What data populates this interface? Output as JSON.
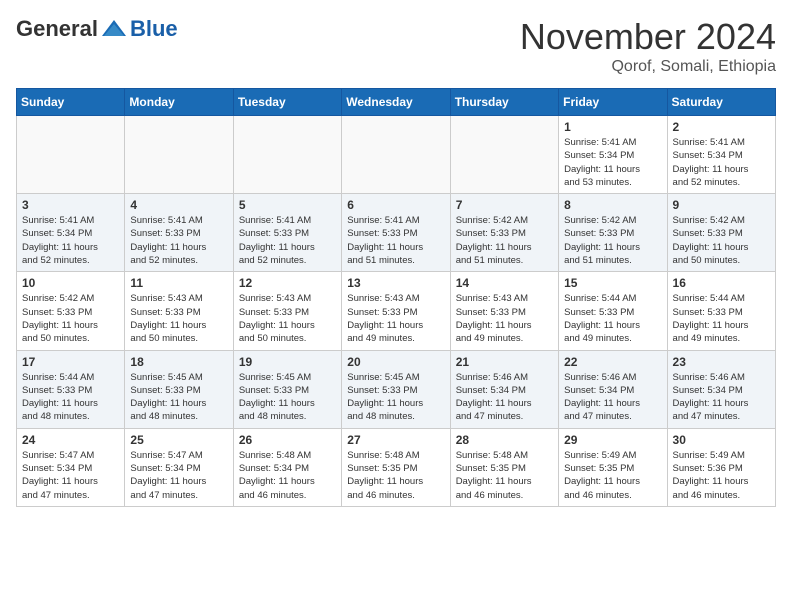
{
  "logo": {
    "general": "General",
    "blue": "Blue"
  },
  "header": {
    "month_title": "November 2024",
    "subtitle": "Qorof, Somali, Ethiopia"
  },
  "weekdays": [
    "Sunday",
    "Monday",
    "Tuesday",
    "Wednesday",
    "Thursday",
    "Friday",
    "Saturday"
  ],
  "weeks": [
    [
      {
        "day": "",
        "info": ""
      },
      {
        "day": "",
        "info": ""
      },
      {
        "day": "",
        "info": ""
      },
      {
        "day": "",
        "info": ""
      },
      {
        "day": "",
        "info": ""
      },
      {
        "day": "1",
        "info": "Sunrise: 5:41 AM\nSunset: 5:34 PM\nDaylight: 11 hours\nand 53 minutes."
      },
      {
        "day": "2",
        "info": "Sunrise: 5:41 AM\nSunset: 5:34 PM\nDaylight: 11 hours\nand 52 minutes."
      }
    ],
    [
      {
        "day": "3",
        "info": "Sunrise: 5:41 AM\nSunset: 5:34 PM\nDaylight: 11 hours\nand 52 minutes."
      },
      {
        "day": "4",
        "info": "Sunrise: 5:41 AM\nSunset: 5:33 PM\nDaylight: 11 hours\nand 52 minutes."
      },
      {
        "day": "5",
        "info": "Sunrise: 5:41 AM\nSunset: 5:33 PM\nDaylight: 11 hours\nand 52 minutes."
      },
      {
        "day": "6",
        "info": "Sunrise: 5:41 AM\nSunset: 5:33 PM\nDaylight: 11 hours\nand 51 minutes."
      },
      {
        "day": "7",
        "info": "Sunrise: 5:42 AM\nSunset: 5:33 PM\nDaylight: 11 hours\nand 51 minutes."
      },
      {
        "day": "8",
        "info": "Sunrise: 5:42 AM\nSunset: 5:33 PM\nDaylight: 11 hours\nand 51 minutes."
      },
      {
        "day": "9",
        "info": "Sunrise: 5:42 AM\nSunset: 5:33 PM\nDaylight: 11 hours\nand 50 minutes."
      }
    ],
    [
      {
        "day": "10",
        "info": "Sunrise: 5:42 AM\nSunset: 5:33 PM\nDaylight: 11 hours\nand 50 minutes."
      },
      {
        "day": "11",
        "info": "Sunrise: 5:43 AM\nSunset: 5:33 PM\nDaylight: 11 hours\nand 50 minutes."
      },
      {
        "day": "12",
        "info": "Sunrise: 5:43 AM\nSunset: 5:33 PM\nDaylight: 11 hours\nand 50 minutes."
      },
      {
        "day": "13",
        "info": "Sunrise: 5:43 AM\nSunset: 5:33 PM\nDaylight: 11 hours\nand 49 minutes."
      },
      {
        "day": "14",
        "info": "Sunrise: 5:43 AM\nSunset: 5:33 PM\nDaylight: 11 hours\nand 49 minutes."
      },
      {
        "day": "15",
        "info": "Sunrise: 5:44 AM\nSunset: 5:33 PM\nDaylight: 11 hours\nand 49 minutes."
      },
      {
        "day": "16",
        "info": "Sunrise: 5:44 AM\nSunset: 5:33 PM\nDaylight: 11 hours\nand 49 minutes."
      }
    ],
    [
      {
        "day": "17",
        "info": "Sunrise: 5:44 AM\nSunset: 5:33 PM\nDaylight: 11 hours\nand 48 minutes."
      },
      {
        "day": "18",
        "info": "Sunrise: 5:45 AM\nSunset: 5:33 PM\nDaylight: 11 hours\nand 48 minutes."
      },
      {
        "day": "19",
        "info": "Sunrise: 5:45 AM\nSunset: 5:33 PM\nDaylight: 11 hours\nand 48 minutes."
      },
      {
        "day": "20",
        "info": "Sunrise: 5:45 AM\nSunset: 5:33 PM\nDaylight: 11 hours\nand 48 minutes."
      },
      {
        "day": "21",
        "info": "Sunrise: 5:46 AM\nSunset: 5:34 PM\nDaylight: 11 hours\nand 47 minutes."
      },
      {
        "day": "22",
        "info": "Sunrise: 5:46 AM\nSunset: 5:34 PM\nDaylight: 11 hours\nand 47 minutes."
      },
      {
        "day": "23",
        "info": "Sunrise: 5:46 AM\nSunset: 5:34 PM\nDaylight: 11 hours\nand 47 minutes."
      }
    ],
    [
      {
        "day": "24",
        "info": "Sunrise: 5:47 AM\nSunset: 5:34 PM\nDaylight: 11 hours\nand 47 minutes."
      },
      {
        "day": "25",
        "info": "Sunrise: 5:47 AM\nSunset: 5:34 PM\nDaylight: 11 hours\nand 47 minutes."
      },
      {
        "day": "26",
        "info": "Sunrise: 5:48 AM\nSunset: 5:34 PM\nDaylight: 11 hours\nand 46 minutes."
      },
      {
        "day": "27",
        "info": "Sunrise: 5:48 AM\nSunset: 5:35 PM\nDaylight: 11 hours\nand 46 minutes."
      },
      {
        "day": "28",
        "info": "Sunrise: 5:48 AM\nSunset: 5:35 PM\nDaylight: 11 hours\nand 46 minutes."
      },
      {
        "day": "29",
        "info": "Sunrise: 5:49 AM\nSunset: 5:35 PM\nDaylight: 11 hours\nand 46 minutes."
      },
      {
        "day": "30",
        "info": "Sunrise: 5:49 AM\nSunset: 5:36 PM\nDaylight: 11 hours\nand 46 minutes."
      }
    ]
  ]
}
